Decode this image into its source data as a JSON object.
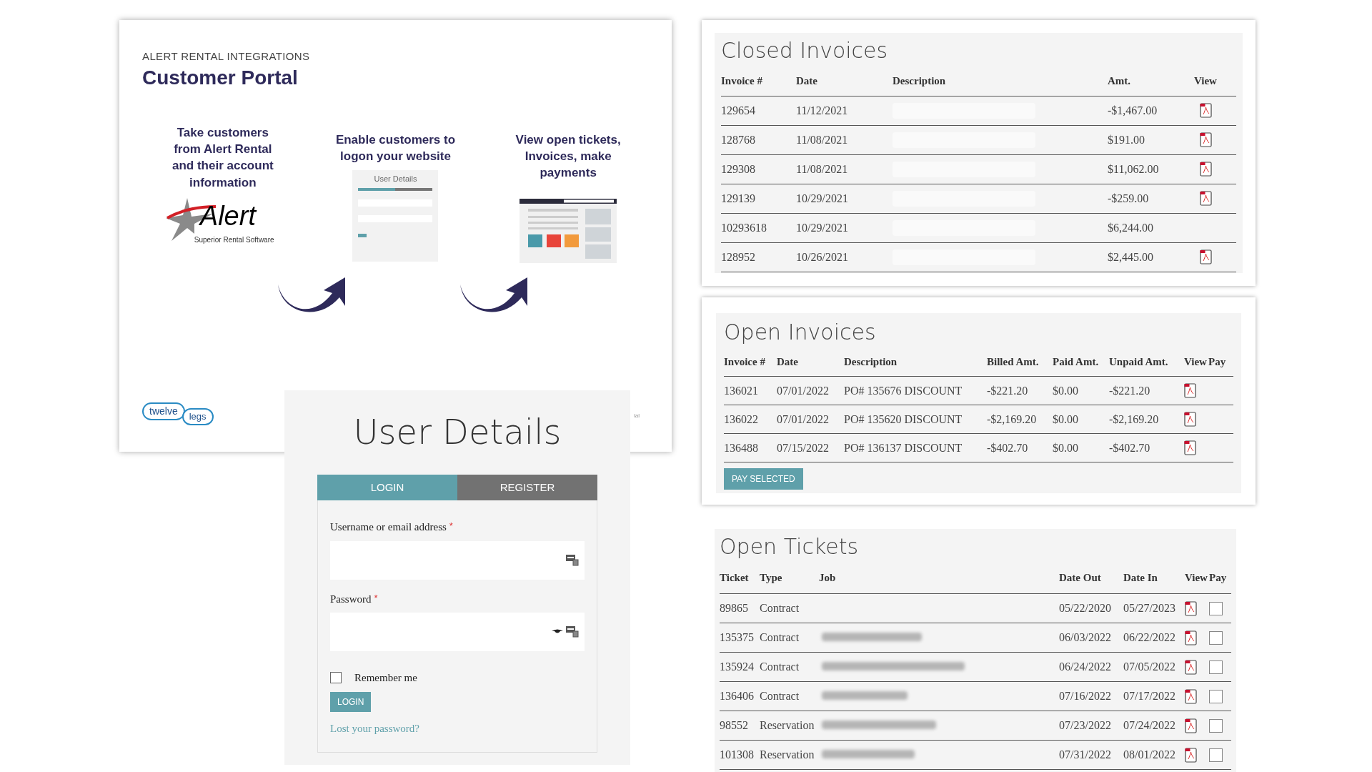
{
  "slide": {
    "eyebrow": "ALERT RENTAL INTEGRATIONS",
    "title": "Customer Portal",
    "steps": [
      {
        "text": "Take customers from Alert Rental and their account information",
        "kind": "logo"
      },
      {
        "text": "Enable customers to logon your website",
        "kind": "login"
      },
      {
        "text": "View open tickets, Invoices, make payments",
        "kind": "browser"
      }
    ],
    "alert_logo": {
      "name": "Alert",
      "tagline": "Superior Rental Software"
    },
    "thumbnail_title": "User Details",
    "brand_logo": {
      "first": "twelve",
      "second": "legs"
    },
    "footnote": "ial"
  },
  "login": {
    "title": "User Details",
    "tabs": [
      {
        "label": "LOGIN",
        "selected": true
      },
      {
        "label": "REGISTER",
        "selected": false
      }
    ],
    "fields": [
      {
        "label": "Username or email address",
        "required_mark": "*",
        "kind": "text"
      },
      {
        "label": "Password",
        "required_mark": "*",
        "kind": "password"
      }
    ],
    "remember": {
      "label": "Remember me",
      "checked": false
    },
    "button": "LOGIN",
    "link": "Lost your password?"
  },
  "closed_invoices": {
    "title": "Closed Invoices",
    "columns": [
      "Invoice #",
      "Date",
      "Description",
      "Amt.",
      "View"
    ],
    "rows": [
      {
        "invoice": "129654",
        "date": "11/12/2021",
        "amt": "-$1,467.00",
        "pdf": true
      },
      {
        "invoice": "128768",
        "date": "11/08/2021",
        "amt": "$191.00",
        "pdf": true
      },
      {
        "invoice": "129308",
        "date": "11/08/2021",
        "amt": "$11,062.00",
        "pdf": true
      },
      {
        "invoice": "129139",
        "date": "10/29/2021",
        "amt": "-$259.00",
        "pdf": true
      },
      {
        "invoice": "10293618",
        "date": "10/29/2021",
        "amt": "$6,244.00",
        "pdf": false
      },
      {
        "invoice": "128952",
        "date": "10/26/2021",
        "amt": "$2,445.00",
        "pdf": true
      }
    ]
  },
  "open_invoices": {
    "title": "Open Invoices",
    "columns": [
      "Invoice #",
      "Date",
      "Description",
      "Billed Amt.",
      "Paid Amt.",
      "Unpaid Amt.",
      "View",
      "Pay"
    ],
    "rows": [
      {
        "invoice": "136021",
        "date": "07/01/2022",
        "description": "PO# 135676 DISCOUNT",
        "billed": "-$221.20",
        "paid": "$0.00",
        "unpaid": "-$221.20"
      },
      {
        "invoice": "136022",
        "date": "07/01/2022",
        "description": "PO# 135620 DISCOUNT",
        "billed": "-$2,169.20",
        "paid": "$0.00",
        "unpaid": "-$2,169.20"
      },
      {
        "invoice": "136488",
        "date": "07/15/2022",
        "description": "PO# 136137 DISCOUNT",
        "billed": "-$402.70",
        "paid": "$0.00",
        "unpaid": "-$402.70"
      }
    ],
    "button": "PAY SELECTED"
  },
  "open_tickets": {
    "title": "Open Tickets",
    "columns": [
      "Ticket",
      "Type",
      "Job",
      "Date Out",
      "Date In",
      "View",
      "Pay"
    ],
    "rows": [
      {
        "ticket": "89865",
        "type": "Contract",
        "job_redacted": false,
        "date_out": "05/22/2020",
        "date_in": "05/27/2023",
        "checked": false
      },
      {
        "ticket": "135375",
        "type": "Contract",
        "job_redacted": true,
        "date_out": "06/03/2022",
        "date_in": "06/22/2022",
        "checked": false
      },
      {
        "ticket": "135924",
        "type": "Contract",
        "job_redacted": true,
        "date_out": "06/24/2022",
        "date_in": "07/05/2022",
        "checked": false
      },
      {
        "ticket": "136406",
        "type": "Contract",
        "job_redacted": true,
        "date_out": "07/16/2022",
        "date_in": "07/17/2022",
        "checked": false
      },
      {
        "ticket": "98552",
        "type": "Reservation",
        "job_redacted": true,
        "date_out": "07/23/2022",
        "date_in": "07/24/2022",
        "checked": false
      },
      {
        "ticket": "101308",
        "type": "Reservation",
        "job_redacted": true,
        "date_out": "07/31/2022",
        "date_in": "08/01/2022",
        "checked": false
      }
    ]
  }
}
